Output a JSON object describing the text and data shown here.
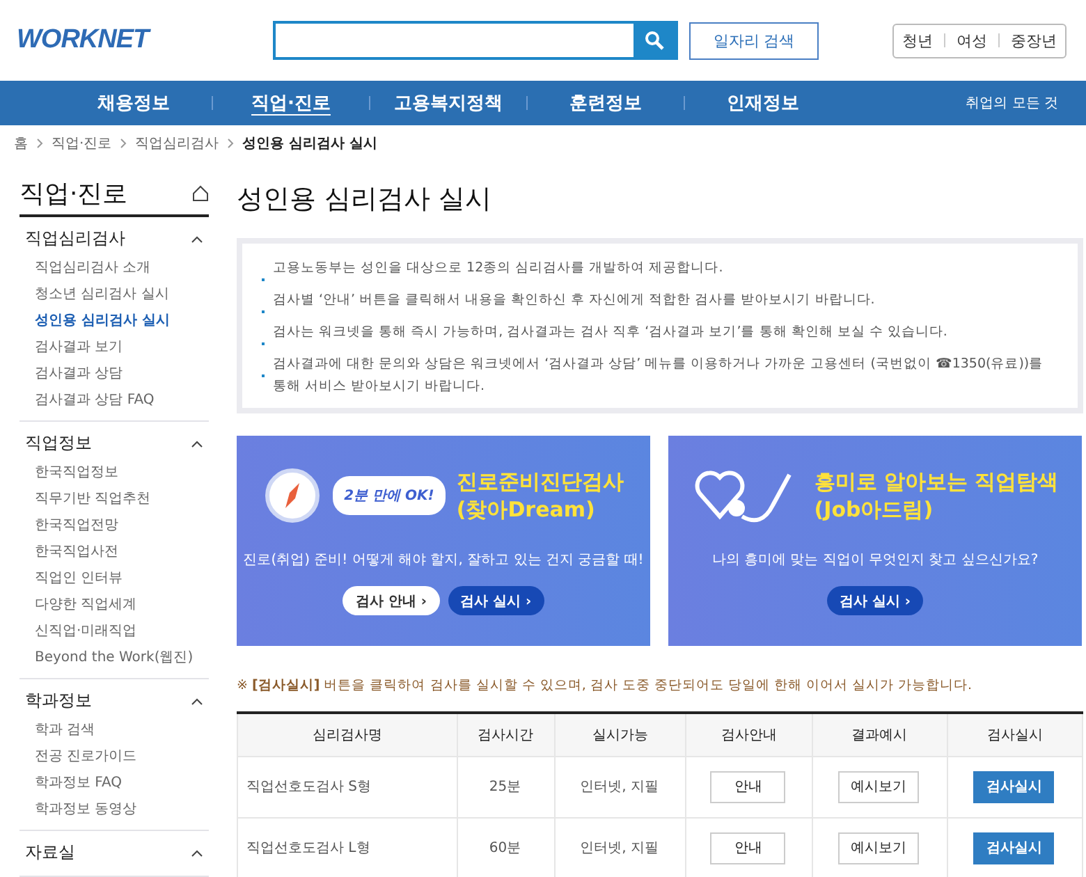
{
  "header": {
    "logo": "WORKNET",
    "job_search_button": "일자리 검색",
    "audience_links": [
      "청년",
      "여성",
      "중장년"
    ]
  },
  "nav": {
    "items": [
      {
        "label": "채용정보",
        "selected": false
      },
      {
        "label": "직업·진로",
        "selected": true
      },
      {
        "label": "고용복지정책",
        "selected": false
      },
      {
        "label": "훈련정보",
        "selected": false
      },
      {
        "label": "인재정보",
        "selected": false
      }
    ],
    "extra": "취업의 모든 것"
  },
  "breadcrumb": [
    "홈",
    "직업·진로",
    "직업심리검사",
    "성인용 심리검사 실시"
  ],
  "sidebar": {
    "title": "직업·진로",
    "sections": [
      {
        "label": "직업심리검사",
        "expanded": true,
        "items": [
          {
            "label": "직업심리검사 소개",
            "selected": false
          },
          {
            "label": "청소년 심리검사 실시",
            "selected": false
          },
          {
            "label": "성인용 심리검사 실시",
            "selected": true
          },
          {
            "label": "검사결과 보기",
            "selected": false
          },
          {
            "label": "검사결과 상담",
            "selected": false
          },
          {
            "label": "검사결과 상담 FAQ",
            "selected": false
          }
        ]
      },
      {
        "label": "직업정보",
        "expanded": true,
        "items": [
          {
            "label": "한국직업정보",
            "selected": false
          },
          {
            "label": "직무기반 직업추천",
            "selected": false
          },
          {
            "label": "한국직업전망",
            "selected": false
          },
          {
            "label": "한국직업사전",
            "selected": false
          },
          {
            "label": "직업인 인터뷰",
            "selected": false
          },
          {
            "label": "다양한 직업세계",
            "selected": false
          },
          {
            "label": "신직업·미래직업",
            "selected": false
          },
          {
            "label": "Beyond the Work(웹진)",
            "selected": false
          }
        ]
      },
      {
        "label": "학과정보",
        "expanded": true,
        "items": [
          {
            "label": "학과 검색",
            "selected": false
          },
          {
            "label": "전공 진로가이드",
            "selected": false
          },
          {
            "label": "학과정보 FAQ",
            "selected": false
          },
          {
            "label": "학과정보 동영상",
            "selected": false
          }
        ]
      },
      {
        "label": "자료실",
        "expanded": true
      }
    ]
  },
  "page_title": "성인용 심리검사 실시",
  "notices": [
    "고용노동부는 성인을 대상으로 12종의 심리검사를 개발하여 제공합니다.",
    "검사별 ‘안내’ 버튼을 클릭해서 내용을 확인하신 후 자신에게 적합한 검사를 받아보시기 바랍니다.",
    "검사는 워크넷을 통해 즉시 가능하며, 검사결과는 검사 직후 ‘검사결과 보기’를 통해 확인해 보실 수 있습니다.",
    "검사결과에 대한 문의와 상담은 워크넷에서 ‘검사결과 상담’ 메뉴를 이용하거나 가까운 고용센터 (국번없이 ☎1350(유료))를 통해 서비스 받아보시기 바랍니다."
  ],
  "banners": [
    {
      "kind": "compass",
      "badge": "2분 만에 OK!",
      "title_lines": [
        "진로준비진단검사",
        "(찾아Dream)"
      ],
      "description": "진로(취업) 준비! 어떻게 해야 할지, 잘하고 있는 건지 궁금할 때!",
      "buttons": [
        {
          "label": "검사 안내 ›",
          "kind": "light"
        },
        {
          "label": "검사 실시 ›",
          "kind": "dark"
        }
      ]
    },
    {
      "kind": "heart",
      "title_lines": [
        "흥미로 알아보는 직업탐색",
        "(Job아드림)"
      ],
      "description": "나의 흥미에 맞는 직업이 무엇인지 찾고 싶으신가요?",
      "buttons": [
        {
          "label": "검사 실시 ›",
          "kind": "dark"
        }
      ]
    }
  ],
  "note": {
    "mark": "※",
    "bold": "[검사실시]",
    "text": "버튼을 클릭하여 검사를 실시할 수 있으며, 검사 도중 중단되어도 당일에 한해 이어서 실시가 가능합니다."
  },
  "table": {
    "columns": [
      "심리검사명",
      "검사시간",
      "실시가능",
      "검사안내",
      "결과예시",
      "검사실시"
    ],
    "rows": [
      {
        "name": "직업선호도검사 S형",
        "time": "25분",
        "mode": "인터넷, 지필",
        "guide": "안내",
        "example": "예시보기",
        "start": "검사실시"
      },
      {
        "name": "직업선호도검사 L형",
        "time": "60분",
        "mode": "인터넷, 지필",
        "guide": "안내",
        "example": "예시보기",
        "start": "검사실시"
      }
    ]
  }
}
